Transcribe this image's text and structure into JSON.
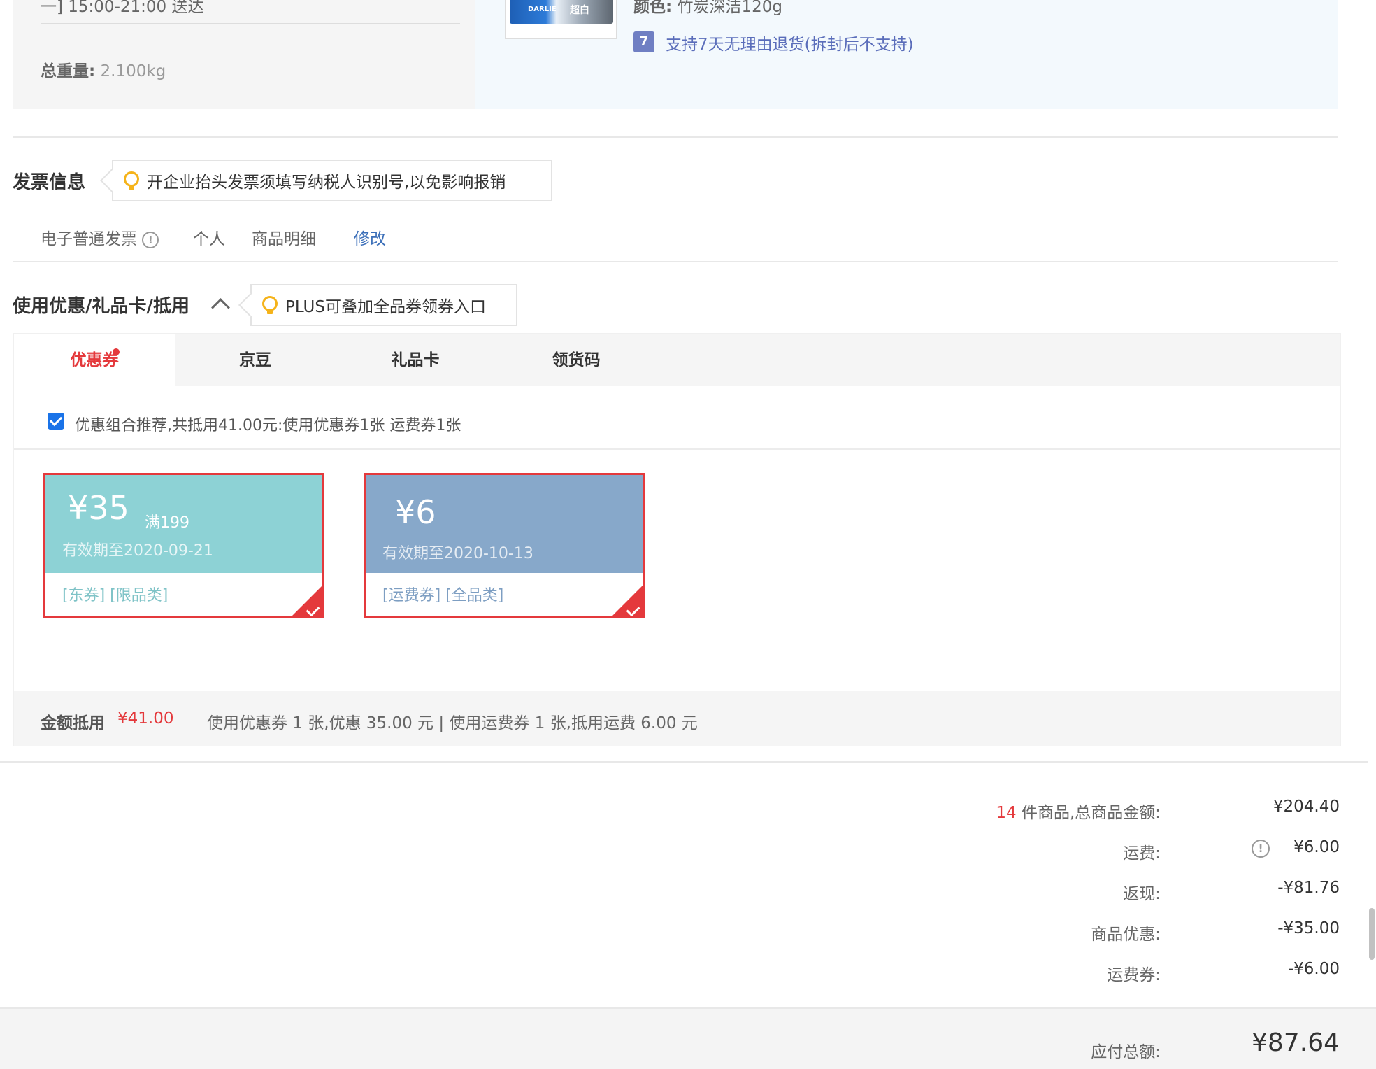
{
  "delivery": {
    "time_text": "一] 15:00-21:00 送达",
    "weight_label": "总重量:",
    "weight_value": "2.100kg"
  },
  "product": {
    "thumb_brand": "DARLIE",
    "thumb_text": "超白",
    "color_label": "颜色:",
    "color_value": "竹炭深洁120g",
    "return_badge": "7",
    "return_policy": "支持7天无理由退货(拆封后不支持)"
  },
  "invoice": {
    "title": "发票信息",
    "tip": "开企业抬头发票须填写纳税人识别号,以免影响报销",
    "type": "电子普通发票",
    "info_icon": "!",
    "holder": "个人",
    "content": "商品明细",
    "edit_link": "修改"
  },
  "discount": {
    "title": "使用优惠/礼品卡/抵用",
    "tip": "PLUS可叠加全品券领券入口",
    "tabs": [
      {
        "label": "优惠券",
        "active": true
      },
      {
        "label": "京豆",
        "active": false
      },
      {
        "label": "礼品卡",
        "active": false
      },
      {
        "label": "领货码",
        "active": false
      }
    ],
    "recommend_text": "优惠组合推荐,共抵用41.00元:使用优惠券1张 运费券1张",
    "coupons": [
      {
        "amount": "¥35",
        "condition": "满199",
        "valid": "有效期至2020-09-21",
        "tags": "[东券] [限品类]",
        "color": "#8dd2d5",
        "tag_color": "#7fc3c7",
        "selected": true
      },
      {
        "amount": "¥6",
        "condition": "",
        "valid": "有效期至2020-10-13",
        "tags": "[运费券] [全品类]",
        "color": "#87a8ca",
        "tag_color": "#7d9ec2",
        "selected": true
      }
    ],
    "deduct_label": "金额抵用",
    "deduct_amount": "¥41.00",
    "deduct_detail": "使用优惠券 1 张,优惠 35.00 元 | 使用运费券 1 张,抵用运费 6.00 元"
  },
  "summary": {
    "item_count": "14",
    "items_label": "件商品,总商品金额:",
    "items_value": "¥204.40",
    "shipping_label": "运费:",
    "shipping_value": "¥6.00",
    "cashback_label": "返现:",
    "cashback_value": "-¥81.76",
    "product_discount_label": "商品优惠:",
    "product_discount_value": "-¥35.00",
    "shipping_coupon_label": "运费券:",
    "shipping_coupon_value": "-¥6.00",
    "total_label": "应付总额:",
    "total_value": "¥87.64"
  },
  "colors": {
    "accent": "#e4393c",
    "link": "#005ea7",
    "shipping": "#ff6600"
  }
}
